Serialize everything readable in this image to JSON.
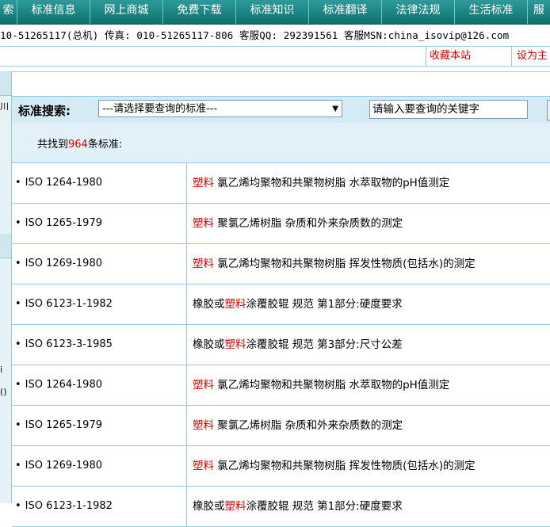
{
  "nav": {
    "items": [
      "索",
      "标准信息",
      "网上商城",
      "免费下载",
      "标准知识",
      "标准翻译",
      "法律法规",
      "生活标准",
      "服"
    ]
  },
  "contact": {
    "text": "10-51265117(总机) 传真: 010-51265117-806 客服QQ: 292391561 客服MSN:china_isovip@126.com"
  },
  "bookmarks": {
    "favorite": "收藏本站",
    "homepage": "设为主"
  },
  "sidebar": {
    "glyph1": "川",
    "glyph2": "i",
    "glyph3": "()"
  },
  "search": {
    "label": "标准搜索:",
    "select_value": "---请选择要查询的标准---",
    "keyword_placeholder": "请输入要查询的关键字"
  },
  "summary": {
    "prefix": "共找到",
    "count": "964",
    "suffix": "条标准:"
  },
  "results": [
    {
      "code": "ISO 1264-1980",
      "pre": "",
      "kw": "塑料",
      "post": " 氯乙烯均聚物和共聚物树脂 水萃取物的pH值测定"
    },
    {
      "code": "ISO 1265-1979",
      "pre": "",
      "kw": "塑料",
      "post": " 聚氯乙烯树脂 杂质和外来杂质数的测定"
    },
    {
      "code": "ISO 1269-1980",
      "pre": "",
      "kw": "塑料",
      "post": " 氯乙烯均聚物和共聚物树脂 挥发性物质(包括水)的测定"
    },
    {
      "code": "ISO 6123-1-1982",
      "pre": "橡胶或",
      "kw": "塑料",
      "post": "涂覆胶辊 规范 第1部分:硬度要求"
    },
    {
      "code": "ISO 6123-3-1985",
      "pre": "橡胶或",
      "kw": "塑料",
      "post": "涂覆胶辊 规范 第3部分:尺寸公差"
    },
    {
      "code": "ISO 1264-1980",
      "pre": "",
      "kw": "塑料",
      "post": " 氯乙烯均聚物和共聚物树脂 水萃取物的pH值测定"
    },
    {
      "code": "ISO 1265-1979",
      "pre": "",
      "kw": "塑料",
      "post": " 聚氯乙烯树脂 杂质和外来杂质数的测定"
    },
    {
      "code": "ISO 1269-1980",
      "pre": "",
      "kw": "塑料",
      "post": " 氯乙烯均聚物和共聚物树脂 挥发性物质(包括水)的测定"
    },
    {
      "code": "ISO 6123-1-1982",
      "pre": "橡胶或",
      "kw": "塑料",
      "post": "涂覆胶辊 规范 第1部分:硬度要求"
    }
  ],
  "colors": {
    "nav_bg": "#1a8080",
    "highlight": "#d40000",
    "panel_bg": "#d4ebf5"
  }
}
